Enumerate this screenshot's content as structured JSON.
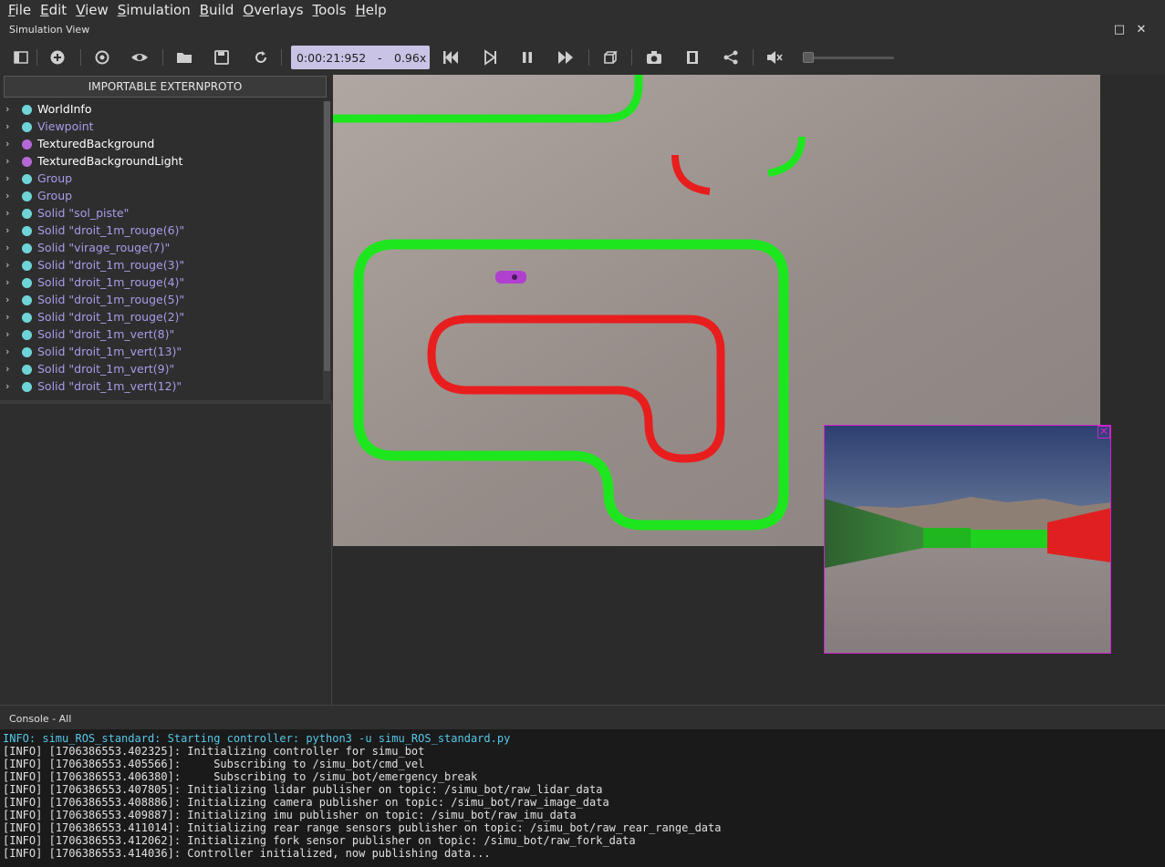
{
  "menu": [
    {
      "ul": "F",
      "rest": "ile"
    },
    {
      "ul": "E",
      "rest": "dit"
    },
    {
      "ul": "V",
      "rest": "iew"
    },
    {
      "ul": "S",
      "rest": "imulation"
    },
    {
      "ul": "B",
      "rest": "uild"
    },
    {
      "ul": "O",
      "rest": "verlays"
    },
    {
      "ul": "T",
      "rest": "ools"
    },
    {
      "ul": "H",
      "rest": "elp"
    }
  ],
  "panel": {
    "title": "Simulation View",
    "maximize": "□",
    "close": "✕"
  },
  "toolbar": {
    "time": "0:00:21:952",
    "time_sep": "-",
    "speed": "0.96x",
    "volume_level": 0.0
  },
  "scene_tree": {
    "import_button": "IMPORTABLE EXTERNPROTO",
    "items": [
      {
        "label": "WorldInfo",
        "color": "#6fd4d8",
        "label_color": "#ffffff"
      },
      {
        "label": "Viewpoint",
        "color": "#6fd4d8",
        "label_color": "#a99be8"
      },
      {
        "label": "TexturedBackground",
        "color": "#b46ad6",
        "label_color": "#ffffff"
      },
      {
        "label": "TexturedBackgroundLight",
        "color": "#b46ad6",
        "label_color": "#ffffff"
      },
      {
        "label": "Group",
        "color": "#6fd4d8",
        "label_color": "#a99be8"
      },
      {
        "label": "Group",
        "color": "#6fd4d8",
        "label_color": "#a99be8"
      },
      {
        "label": "Solid \"sol_piste\"",
        "color": "#6fd4d8",
        "label_color": "#a99be8"
      },
      {
        "label": "Solid \"droit_1m_rouge(6)\"",
        "color": "#6fd4d8",
        "label_color": "#a99be8"
      },
      {
        "label": "Solid \"virage_rouge(7)\"",
        "color": "#6fd4d8",
        "label_color": "#a99be8"
      },
      {
        "label": "Solid \"droit_1m_rouge(3)\"",
        "color": "#6fd4d8",
        "label_color": "#a99be8"
      },
      {
        "label": "Solid \"droit_1m_rouge(4)\"",
        "color": "#6fd4d8",
        "label_color": "#a99be8"
      },
      {
        "label": "Solid \"droit_1m_rouge(5)\"",
        "color": "#6fd4d8",
        "label_color": "#a99be8"
      },
      {
        "label": "Solid \"droit_1m_rouge(2)\"",
        "color": "#6fd4d8",
        "label_color": "#a99be8"
      },
      {
        "label": "Solid \"droit_1m_vert(8)\"",
        "color": "#6fd4d8",
        "label_color": "#a99be8"
      },
      {
        "label": "Solid \"droit_1m_vert(13)\"",
        "color": "#6fd4d8",
        "label_color": "#a99be8"
      },
      {
        "label": "Solid \"droit_1m_vert(9)\"",
        "color": "#6fd4d8",
        "label_color": "#a99be8"
      },
      {
        "label": "Solid \"droit_1m_vert(12)\"",
        "color": "#6fd4d8",
        "label_color": "#a99be8"
      }
    ]
  },
  "camera_overlay": {
    "close": "✕"
  },
  "console": {
    "title": "Console - All",
    "lines": [
      {
        "text": "INFO: simu_ROS_standard: Starting controller: python3 -u simu_ROS_standard.py",
        "kind": "info"
      },
      {
        "text": "[INFO] [1706386553.402325]: Initializing controller for simu_bot",
        "kind": "log"
      },
      {
        "text": "[INFO] [1706386553.405566]:     Subscribing to /simu_bot/cmd_vel",
        "kind": "log"
      },
      {
        "text": "[INFO] [1706386553.406380]:     Subscribing to /simu_bot/emergency_break",
        "kind": "log"
      },
      {
        "text": "[INFO] [1706386553.407805]: Initializing lidar publisher on topic: /simu_bot/raw_lidar_data",
        "kind": "log"
      },
      {
        "text": "[INFO] [1706386553.408886]: Initializing camera publisher on topic: /simu_bot/raw_image_data",
        "kind": "log"
      },
      {
        "text": "[INFO] [1706386553.409887]: Initializing imu publisher on topic: /simu_bot/raw_imu_data",
        "kind": "log"
      },
      {
        "text": "[INFO] [1706386553.411014]: Initializing rear range sensors publisher on topic: /simu_bot/raw_rear_range_data",
        "kind": "log"
      },
      {
        "text": "[INFO] [1706386553.412062]: Initializing fork sensor publisher on topic: /simu_bot/raw_fork_data",
        "kind": "log"
      },
      {
        "text": "[INFO] [1706386553.414036]: Controller initialized, now publishing data...",
        "kind": "log"
      }
    ]
  },
  "colors": {
    "track_green": "#1ee61e",
    "track_red": "#e81e1e",
    "robot": "#b040d0",
    "time_box": "#c9c4e6"
  }
}
